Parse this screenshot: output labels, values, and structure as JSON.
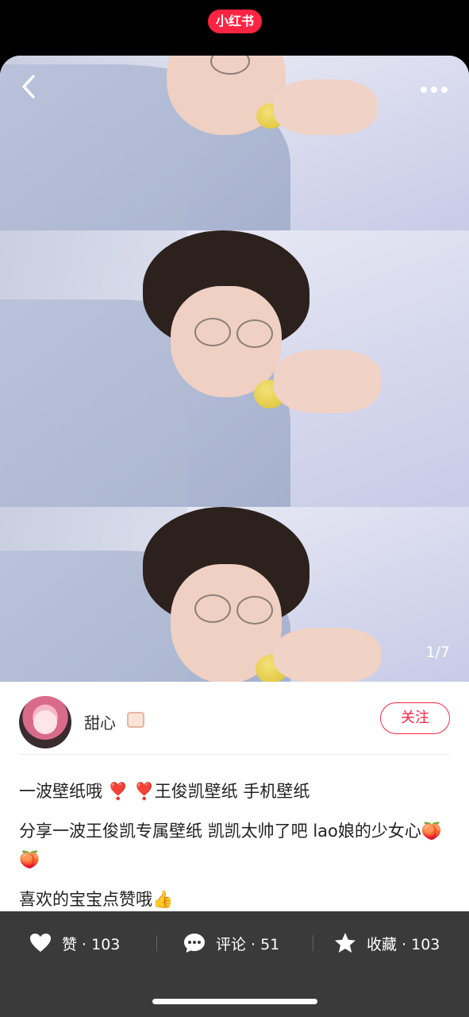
{
  "app": {
    "brand": "小红书",
    "brand_color": "#ff2442"
  },
  "gallery": {
    "page_indicator": "1/7",
    "back_icon": "chevron-left-icon",
    "more_icon": "more-horizontal-icon"
  },
  "author": {
    "name": "甜心",
    "follow_label": "关注"
  },
  "post": {
    "line1": "一波壁纸哦",
    "line1_heart1": "❣️",
    "line1_heart2": "❣️",
    "line1_tail": "王俊凯壁纸  手机壁纸",
    "line2": "分享一波王俊凯专属壁纸    凯凯太帅了吧  lao娘的少女心🍑 🍑",
    "line3": "喜欢的宝宝点赞哦👍"
  },
  "actions": {
    "like_label": "赞 · 103",
    "comment_label": "评论 · 51",
    "collect_label": "收藏 · 103"
  }
}
